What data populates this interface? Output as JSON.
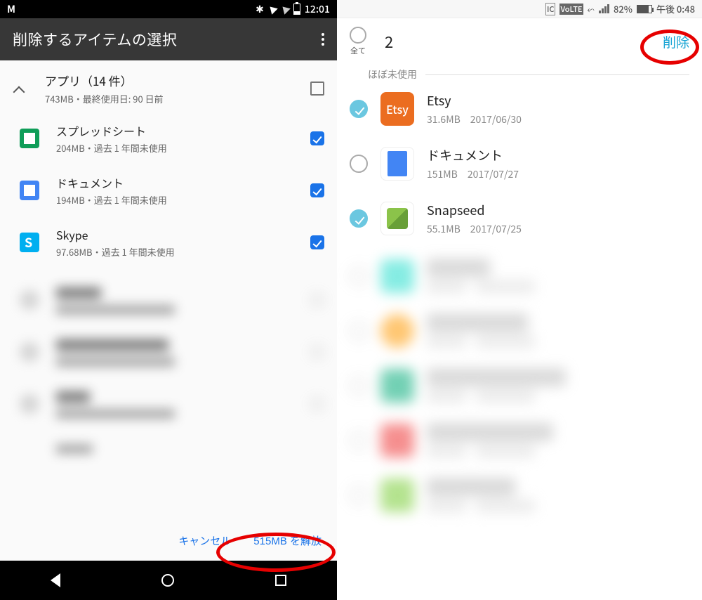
{
  "left": {
    "status": {
      "time": "12:01"
    },
    "appbar": {
      "title": "削除するアイテムの選択"
    },
    "header": {
      "title": "アプリ（14 件）",
      "subtitle": "743MB・最終使用日: 90 日前"
    },
    "items": [
      {
        "name": "スプレッドシート",
        "detail": "204MB・過去 1 年間未使用"
      },
      {
        "name": "ドキュメント",
        "detail": "194MB・過去 1 年間未使用"
      },
      {
        "name": "Skype",
        "detail": "97.68MB・過去 1 年間未使用"
      }
    ],
    "actions": {
      "cancel": "キャンセル",
      "free": "515MB を解放"
    }
  },
  "right": {
    "status": {
      "battery": "82%",
      "time": "午後 0:48"
    },
    "appbar": {
      "all_label": "全て",
      "count": "2",
      "delete": "削除"
    },
    "section": "ほぼ未使用",
    "items": [
      {
        "name": "Etsy",
        "size": "31.6MB",
        "date": "2017/06/30",
        "checked": true,
        "iconText": "Etsy"
      },
      {
        "name": "ドキュメント",
        "size": "151MB",
        "date": "2017/07/27",
        "checked": false
      },
      {
        "name": "Snapseed",
        "size": "55.1MB",
        "date": "2017/07/25",
        "checked": true
      }
    ]
  }
}
